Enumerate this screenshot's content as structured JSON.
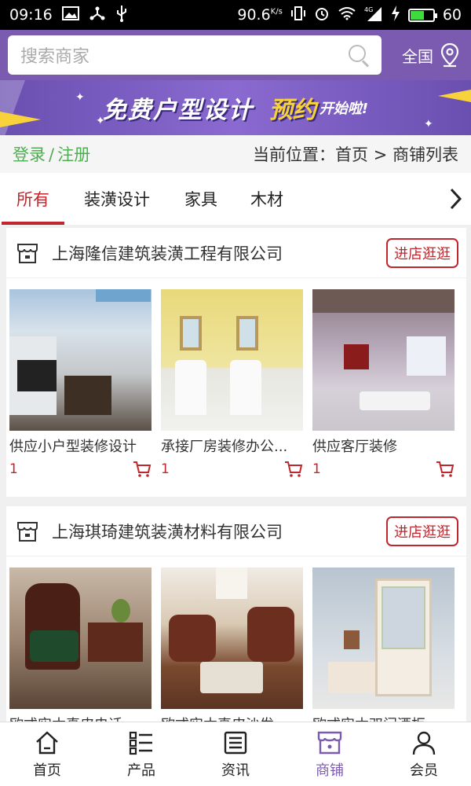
{
  "status_bar": {
    "time": "09:16",
    "speed": "90.6",
    "speed_unit": "K/s",
    "network": "4G",
    "battery": "60",
    "battery_level": 0.6
  },
  "search": {
    "placeholder": "搜索商家",
    "region_label": "全国"
  },
  "banner": {
    "main_text": "免费户型设计",
    "highlight_text": "预约",
    "tail_text": "开始啦!"
  },
  "auth": {
    "login": "登录",
    "separator": "/",
    "register": "注册"
  },
  "breadcrumb": "当前位置：首页 > 商铺列表",
  "tabs": [
    {
      "label": "所有",
      "active": true
    },
    {
      "label": "装潢设计",
      "active": false
    },
    {
      "label": "家具",
      "active": false
    },
    {
      "label": "木材",
      "active": false
    }
  ],
  "shops": [
    {
      "name": "上海隆信建筑装潢工程有限公司",
      "enter_label": "进店逛逛",
      "products": [
        {
          "name": "供应小户型装修设计",
          "price": "1"
        },
        {
          "name": "承接厂房装修办公...",
          "price": "1"
        },
        {
          "name": "供应客厅装修",
          "price": "1"
        }
      ]
    },
    {
      "name": "上海琪琦建筑装潢材料有限公司",
      "enter_label": "进店逛逛",
      "products": [
        {
          "name": "欧式实木真皮电话...",
          "price": ""
        },
        {
          "name": "欧式实木真皮沙发...",
          "price": ""
        },
        {
          "name": "欧式实木双门酒柜...",
          "price": ""
        }
      ]
    }
  ],
  "bottom_nav": [
    {
      "label": "首页",
      "icon": "home-icon",
      "active": false
    },
    {
      "label": "产品",
      "icon": "list-icon",
      "active": false
    },
    {
      "label": "资讯",
      "icon": "news-icon",
      "active": false
    },
    {
      "label": "商铺",
      "icon": "store-icon",
      "active": true
    },
    {
      "label": "会员",
      "icon": "user-icon",
      "active": false
    }
  ],
  "colors": {
    "brand_purple": "#7b5bb0",
    "accent_red": "#c0262d",
    "login_green": "#4caf50"
  }
}
